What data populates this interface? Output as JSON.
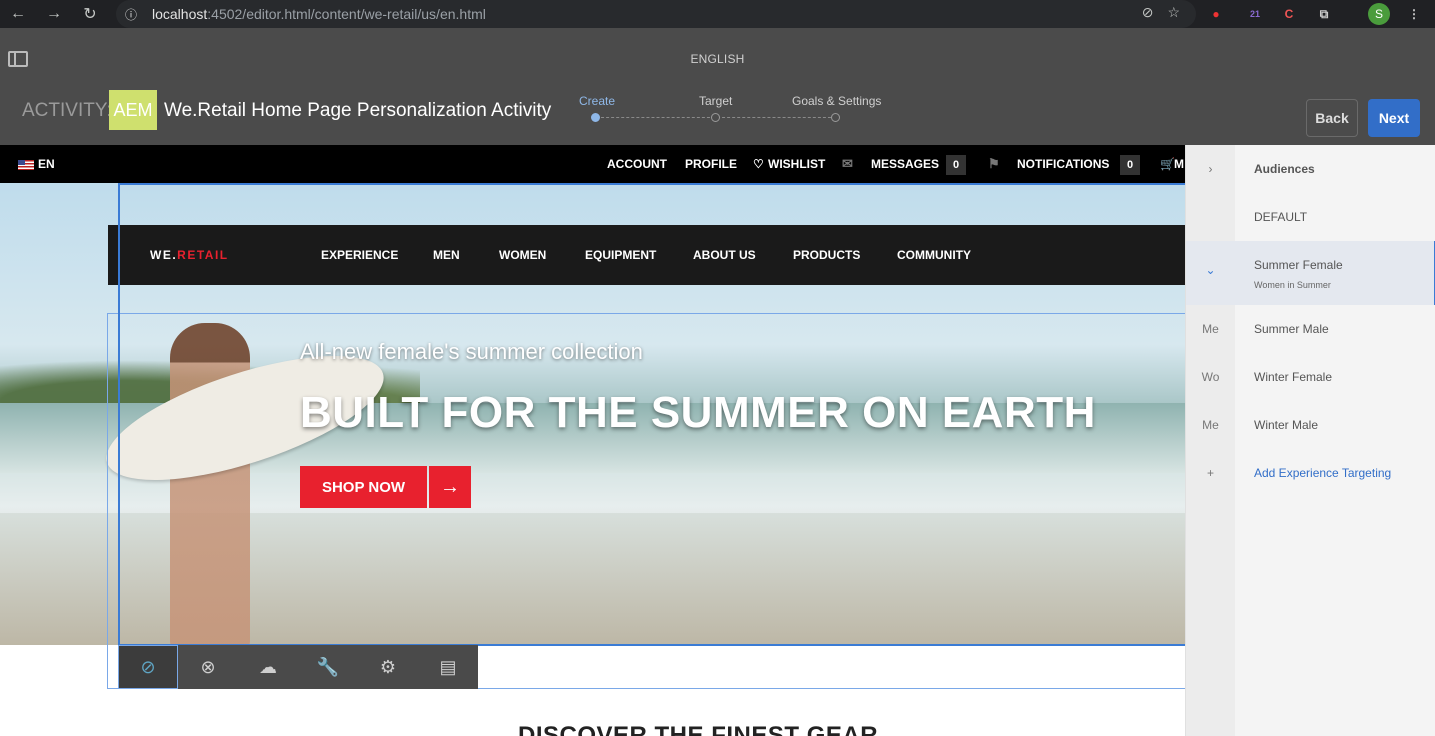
{
  "browser": {
    "url_host": "localhost",
    "url_rest": ":4502/editor.html/content/we-retail/us/en.html",
    "ext_badge": "21",
    "profile_initial": "S"
  },
  "header": {
    "language": "ENGLISH",
    "activity_label": "ACTIVITY:",
    "badge": "AEM",
    "activity_name": "We.Retail Home Page Personalization Activity",
    "steps": [
      "Create",
      "Target",
      "Goals & Settings"
    ],
    "back_label": "Back",
    "next_label": "Next"
  },
  "site": {
    "lang": "EN",
    "topbar": {
      "account": "ACCOUNT",
      "profile": "PROFILE",
      "wishlist": "WISHLIST",
      "messages": "MESSAGES",
      "messages_count": "0",
      "notifications": "NOTIFICATIONS",
      "notifications_count": "0",
      "cart": "M"
    },
    "logo_a": "WE.",
    "logo_b": "RETAIL",
    "nav": [
      "EXPERIENCE",
      "MEN",
      "WOMEN",
      "EQUIPMENT",
      "ABOUT US",
      "PRODUCTS",
      "COMMUNITY"
    ],
    "hero_sub": "All-new female's summer collection",
    "hero_title": "BUILT FOR THE SUMMER ON EARTH",
    "shop_now": "SHOP NOW",
    "discover": "DISCOVER THE FINEST GEAR"
  },
  "rail": {
    "title": "Audiences",
    "items": [
      {
        "gutter": "",
        "label": "DEFAULT",
        "sub": ""
      },
      {
        "gutter": "⌄",
        "label": "Summer Female",
        "sub": "Women in Summer"
      },
      {
        "gutter": "Me",
        "label": "Summer Male",
        "sub": ""
      },
      {
        "gutter": "Wo",
        "label": "Winter Female",
        "sub": ""
      },
      {
        "gutter": "Me",
        "label": "Winter Male",
        "sub": ""
      }
    ],
    "add_label": "Add Experience Targeting"
  },
  "colors": {
    "accent": "#326ec8",
    "brand_red": "#e8212e",
    "badge": "#cfe06e"
  }
}
